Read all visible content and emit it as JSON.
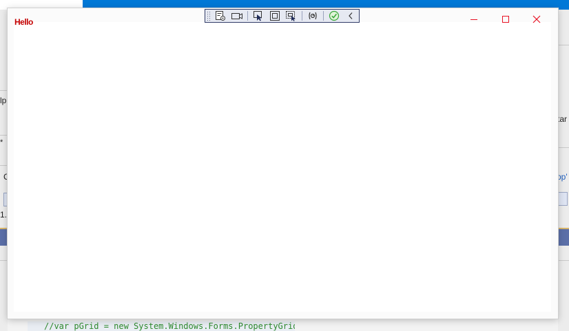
{
  "window": {
    "title": "Hello"
  },
  "background": {
    "fragment_lp": "lp",
    "fragment_star": "*",
    "fragment_c": "C",
    "fragment_1": "1.",
    "fragment_tar": "tar",
    "fragment_pp": "pp'",
    "code_line": "//var pGrid = new System.Windows.Forms.PropertyGrid"
  },
  "toolbar": {
    "buttons": [
      {
        "icon": "live-visual-tree-icon"
      },
      {
        "icon": "camera-icon"
      },
      {
        "icon": "select-element-icon"
      },
      {
        "icon": "display-layout-adorners-icon"
      },
      {
        "icon": "track-focused-element-icon"
      },
      {
        "icon": "binding-failures-icon"
      },
      {
        "icon": "hot-reload-ok-icon"
      },
      {
        "icon": "collapse-toolbar-icon"
      }
    ]
  },
  "colors": {
    "title": "#c40000",
    "caption_glyph": "#e81123",
    "accent": "#0078d7",
    "hot_reload_ok": "#3aa83a"
  }
}
